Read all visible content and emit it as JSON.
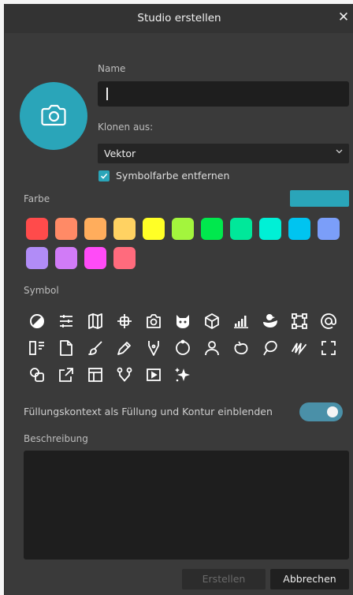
{
  "dialog": {
    "title": "Studio erstellen",
    "close_icon": "close-icon"
  },
  "avatar": {
    "icon": "camera-icon",
    "color": "#2aa5b9"
  },
  "name": {
    "label": "Name",
    "value": ""
  },
  "clone": {
    "label": "Klonen aus:",
    "value": "Vektor"
  },
  "remove_symbol_color": {
    "label": "Symbolfarbe entfernen",
    "checked": true
  },
  "color": {
    "label": "Farbe",
    "selected": "#2aa5b9",
    "swatches": [
      "#ff4b4b",
      "#ff8a66",
      "#ffad5c",
      "#ffd262",
      "#ffff26",
      "#a3f53d",
      "#00e84d",
      "#00e89a",
      "#00f0d6",
      "#00c4f0",
      "#7b9ef9",
      "#b18cf7",
      "#d17bf7",
      "#ff4bf7",
      "#ff6b7d"
    ]
  },
  "symbol": {
    "label": "Symbol",
    "icons": [
      "contrast-icon",
      "sliders-icon",
      "book-icon",
      "crosshair-icon",
      "camera-icon",
      "cat-icon",
      "cube-icon",
      "signal-icon",
      "duck-icon",
      "vector-frame-icon",
      "at-icon",
      "columns-icon",
      "document-icon",
      "brush-icon",
      "pen-icon",
      "pen-nib-icon",
      "circle-icon",
      "person-icon",
      "blob-icon",
      "lasso-icon",
      "scribble-icon",
      "frame-corners-icon",
      "shapes-icon",
      "export-icon",
      "layout-icon",
      "node-icon",
      "play-box-icon",
      "sparkle-icon"
    ]
  },
  "fill_context": {
    "label": "Füllungskontext als Füllung und Kontur einblenden",
    "enabled": true
  },
  "description": {
    "label": "Beschreibung",
    "value": ""
  },
  "buttons": {
    "create": "Erstellen",
    "cancel": "Abbrechen"
  }
}
